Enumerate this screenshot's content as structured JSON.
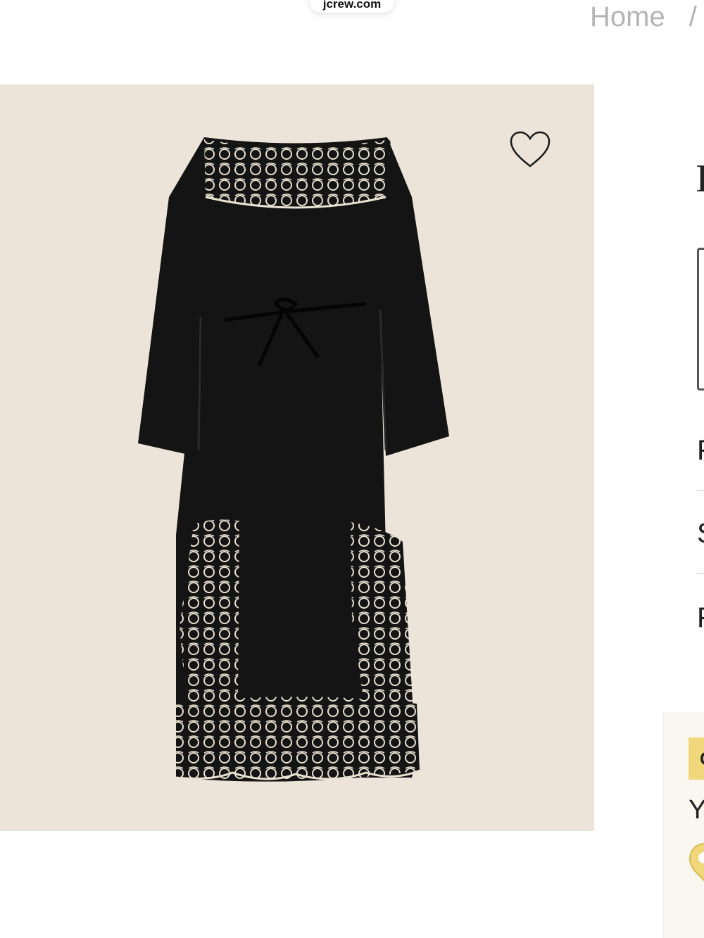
{
  "browser": {
    "url": "jcrew.com"
  },
  "breadcrumb": {
    "home": "Home",
    "separator": "/"
  },
  "product": {
    "title_fragment": "I",
    "image_alt": "Black long-sleeve midi dress with cream cutwork embroidery and tie waist",
    "colors": {
      "background": "#ece4d8",
      "dress": "#141414",
      "embroidery": "#e9e2d2"
    }
  },
  "details": {
    "row1": "F",
    "row2": "S",
    "row3": "F"
  },
  "promo": {
    "badge": "C",
    "text": "Yo"
  },
  "icons": {
    "favorite": "heart-outline-icon",
    "promo": "location-pin-icon"
  }
}
